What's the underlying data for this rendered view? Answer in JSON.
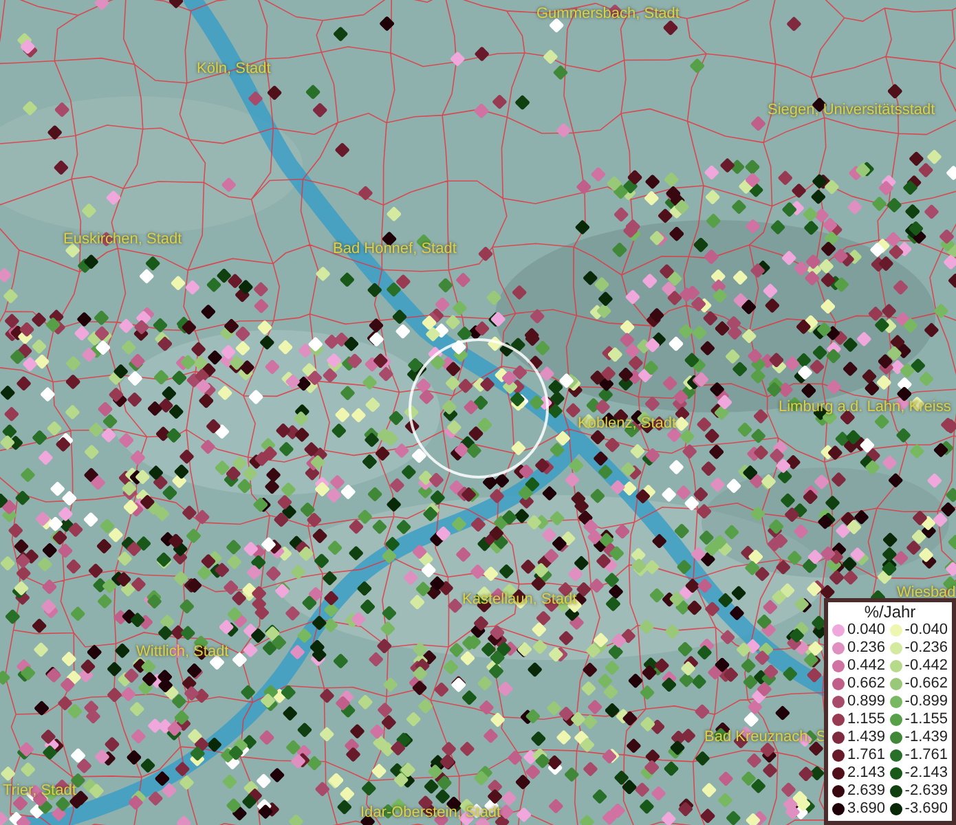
{
  "map": {
    "labels": [
      {
        "text": "Gummersbach, Stadt"
      },
      {
        "text": "Köln, Stadt"
      },
      {
        "text": "Siegen, Universitätsstadt"
      },
      {
        "text": "Euskirchen, Stadt"
      },
      {
        "text": "Bad Honnef, Stadt"
      },
      {
        "text": "Limburg a.d. Lahn, Kreiss"
      },
      {
        "text": "Koblenz, Stadt"
      },
      {
        "text": "Wiesbad"
      },
      {
        "text": "Kastellaun, Stadt"
      },
      {
        "text": "Wittlich, Stadt"
      },
      {
        "text": "Bad Kreuznach, S"
      },
      {
        "text": "Trier, Stadt"
      },
      {
        "text": "Idar-Oberstein, Stadt"
      }
    ]
  },
  "legend": {
    "title": "%/Jahr",
    "rows": [
      {
        "positive": {
          "value": "0.040",
          "color": "#f0a8dc"
        },
        "negative": {
          "value": "-0.040",
          "color": "#eef6b0"
        }
      },
      {
        "positive": {
          "value": "0.236",
          "color": "#e090c0"
        },
        "negative": {
          "value": "-0.236",
          "color": "#d4eaa0"
        }
      },
      {
        "positive": {
          "value": "0.442",
          "color": "#d072a2"
        },
        "negative": {
          "value": "-0.442",
          "color": "#b6da8a"
        }
      },
      {
        "positive": {
          "value": "0.662",
          "color": "#c0608a"
        },
        "negative": {
          "value": "-0.662",
          "color": "#98c878"
        }
      },
      {
        "positive": {
          "value": "0.899",
          "color": "#a84a6a"
        },
        "negative": {
          "value": "-0.899",
          "color": "#78b860"
        }
      },
      {
        "positive": {
          "value": "1.155",
          "color": "#983a52"
        },
        "negative": {
          "value": "-1.155",
          "color": "#58a048"
        }
      },
      {
        "positive": {
          "value": "1.439",
          "color": "#802a40"
        },
        "negative": {
          "value": "-1.439",
          "color": "#408838"
        }
      },
      {
        "positive": {
          "value": "1.761",
          "color": "#681a2a"
        },
        "negative": {
          "value": "-1.761",
          "color": "#287028"
        }
      },
      {
        "positive": {
          "value": "2.143",
          "color": "#50101a"
        },
        "negative": {
          "value": "-2.143",
          "color": "#185818"
        }
      },
      {
        "positive": {
          "value": "2.639",
          "color": "#380810"
        },
        "negative": {
          "value": "-2.639",
          "color": "#104010"
        }
      },
      {
        "positive": {
          "value": "3.690",
          "color": "#200008"
        },
        "negative": {
          "value": "-3.690",
          "color": "#082808"
        }
      }
    ]
  }
}
